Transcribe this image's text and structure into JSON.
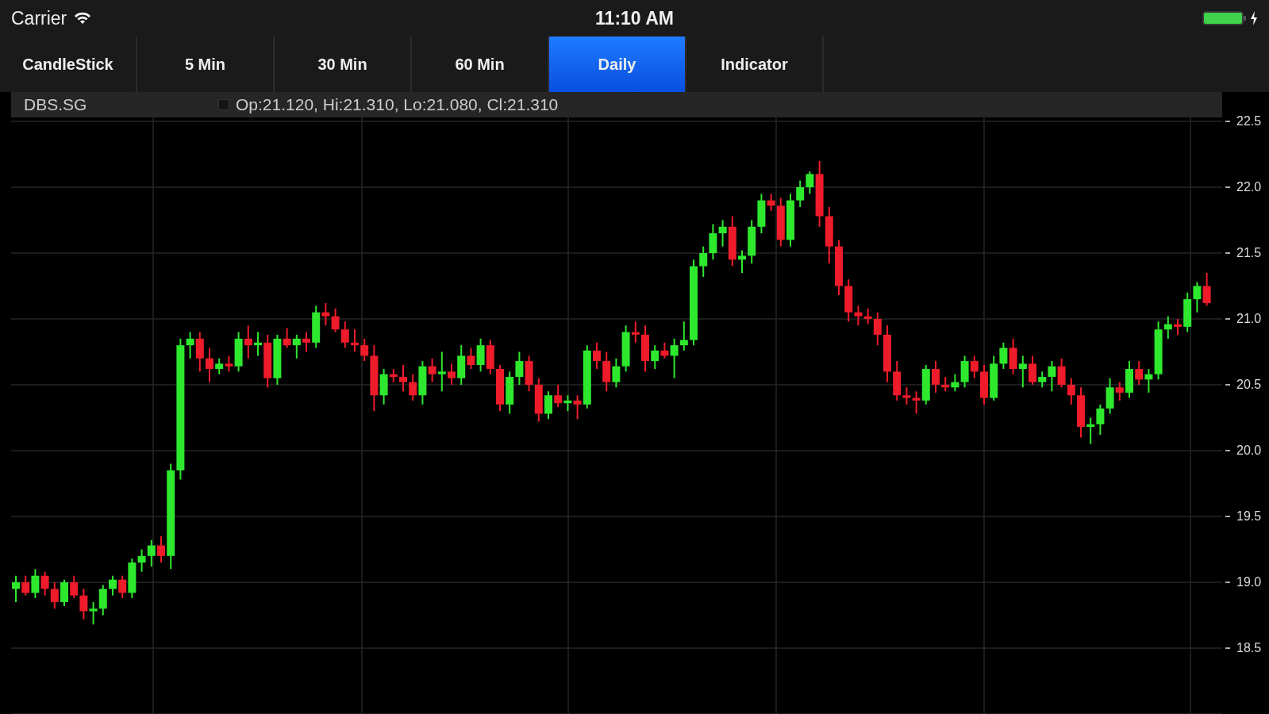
{
  "status_bar": {
    "carrier": "Carrier",
    "time": "11:10 AM"
  },
  "tabs": [
    {
      "label": "CandleStick",
      "selected": false
    },
    {
      "label": "5 Min",
      "selected": false
    },
    {
      "label": "30 Min",
      "selected": false
    },
    {
      "label": "60 Min",
      "selected": false
    },
    {
      "label": "Daily",
      "selected": true
    },
    {
      "label": "Indicator",
      "selected": false
    }
  ],
  "chart": {
    "symbol": "DBS.SG",
    "ohlc_readout": "Op:21.120, Hi:21.310, Lo:21.080, Cl:21.310",
    "chart_data": {
      "type": "candlestick",
      "grid": true,
      "ylim": [
        18.0,
        22.53
      ],
      "yticks": [
        {
          "value": 22.5,
          "label": "22.5"
        },
        {
          "value": 22.0,
          "label": "22.0"
        },
        {
          "value": 21.5,
          "label": "21.5"
        },
        {
          "value": 21.0,
          "label": "21.0"
        },
        {
          "value": 20.5,
          "label": "20.5"
        },
        {
          "value": 20.0,
          "label": "20.0"
        },
        {
          "value": 19.5,
          "label": "19.5"
        },
        {
          "value": 19.0,
          "label": "19.0"
        },
        {
          "value": 18.5,
          "label": "18.5"
        }
      ],
      "ohlc": [
        [
          18.95,
          19.05,
          18.85,
          19.0
        ],
        [
          19.0,
          19.05,
          18.9,
          18.92
        ],
        [
          18.92,
          19.1,
          18.88,
          19.05
        ],
        [
          19.05,
          19.08,
          18.9,
          18.95
        ],
        [
          18.95,
          19.0,
          18.8,
          18.85
        ],
        [
          18.85,
          19.02,
          18.82,
          19.0
        ],
        [
          19.0,
          19.05,
          18.88,
          18.9
        ],
        [
          18.9,
          18.95,
          18.72,
          18.78
        ],
        [
          18.78,
          18.85,
          18.68,
          18.8
        ],
        [
          18.8,
          18.98,
          18.75,
          18.95
        ],
        [
          18.95,
          19.05,
          18.9,
          19.02
        ],
        [
          19.02,
          19.05,
          18.88,
          18.92
        ],
        [
          18.92,
          19.18,
          18.88,
          19.15
        ],
        [
          19.15,
          19.25,
          19.08,
          19.2
        ],
        [
          19.2,
          19.32,
          19.12,
          19.28
        ],
        [
          19.28,
          19.35,
          19.15,
          19.2
        ],
        [
          19.2,
          19.9,
          19.1,
          19.85
        ],
        [
          19.85,
          20.85,
          19.78,
          20.8
        ],
        [
          20.8,
          20.9,
          20.7,
          20.85
        ],
        [
          20.85,
          20.9,
          20.6,
          20.7
        ],
        [
          20.7,
          20.78,
          20.52,
          20.62
        ],
        [
          20.62,
          20.7,
          20.58,
          20.66
        ],
        [
          20.66,
          20.72,
          20.6,
          20.64
        ],
        [
          20.64,
          20.9,
          20.6,
          20.85
        ],
        [
          20.85,
          20.95,
          20.7,
          20.8
        ],
        [
          20.8,
          20.9,
          20.72,
          20.82
        ],
        [
          20.82,
          20.88,
          20.48,
          20.55
        ],
        [
          20.55,
          20.88,
          20.5,
          20.85
        ],
        [
          20.85,
          20.93,
          20.78,
          20.8
        ],
        [
          20.8,
          20.88,
          20.7,
          20.85
        ],
        [
          20.85,
          20.9,
          20.75,
          20.82
        ],
        [
          20.82,
          21.1,
          20.78,
          21.05
        ],
        [
          21.05,
          21.12,
          20.95,
          21.02
        ],
        [
          21.02,
          21.08,
          20.9,
          20.92
        ],
        [
          20.92,
          20.98,
          20.78,
          20.82
        ],
        [
          20.82,
          20.92,
          20.75,
          20.8
        ],
        [
          20.8,
          20.85,
          20.68,
          20.72
        ],
        [
          20.72,
          20.8,
          20.3,
          20.42
        ],
        [
          20.42,
          20.62,
          20.35,
          20.58
        ],
        [
          20.58,
          20.62,
          20.52,
          20.56
        ],
        [
          20.56,
          20.65,
          20.45,
          20.52
        ],
        [
          20.52,
          20.58,
          20.38,
          20.42
        ],
        [
          20.42,
          20.68,
          20.35,
          20.64
        ],
        [
          20.64,
          20.7,
          20.52,
          20.58
        ],
        [
          20.58,
          20.75,
          20.45,
          20.6
        ],
        [
          20.6,
          20.66,
          20.5,
          20.55
        ],
        [
          20.55,
          20.8,
          20.5,
          20.72
        ],
        [
          20.72,
          20.78,
          20.62,
          20.65
        ],
        [
          20.65,
          20.85,
          20.6,
          20.8
        ],
        [
          20.8,
          20.84,
          20.58,
          20.62
        ],
        [
          20.62,
          20.65,
          20.3,
          20.35
        ],
        [
          20.35,
          20.6,
          20.28,
          20.56
        ],
        [
          20.56,
          20.75,
          20.5,
          20.68
        ],
        [
          20.68,
          20.72,
          20.45,
          20.5
        ],
        [
          20.5,
          20.55,
          20.22,
          20.28
        ],
        [
          20.28,
          20.45,
          20.24,
          20.42
        ],
        [
          20.42,
          20.5,
          20.33,
          20.36
        ],
        [
          20.36,
          20.42,
          20.3,
          20.38
        ],
        [
          20.38,
          20.42,
          20.24,
          20.35
        ],
        [
          20.35,
          20.8,
          20.32,
          20.76
        ],
        [
          20.76,
          20.82,
          20.62,
          20.68
        ],
        [
          20.68,
          20.75,
          20.45,
          20.52
        ],
        [
          20.52,
          20.7,
          20.48,
          20.64
        ],
        [
          20.64,
          20.95,
          20.6,
          20.9
        ],
        [
          20.9,
          20.98,
          20.82,
          20.88
        ],
        [
          20.88,
          20.95,
          20.6,
          20.68
        ],
        [
          20.68,
          20.8,
          20.62,
          20.76
        ],
        [
          20.76,
          20.82,
          20.7,
          20.72
        ],
        [
          20.72,
          20.85,
          20.55,
          20.8
        ],
        [
          20.8,
          20.98,
          20.76,
          20.84
        ],
        [
          20.84,
          21.45,
          20.8,
          21.4
        ],
        [
          21.4,
          21.55,
          21.32,
          21.5
        ],
        [
          21.5,
          21.72,
          21.45,
          21.65
        ],
        [
          21.65,
          21.75,
          21.55,
          21.7
        ],
        [
          21.7,
          21.78,
          21.4,
          21.45
        ],
        [
          21.45,
          21.52,
          21.35,
          21.48
        ],
        [
          21.48,
          21.75,
          21.42,
          21.7
        ],
        [
          21.7,
          21.95,
          21.65,
          21.9
        ],
        [
          21.9,
          21.95,
          21.82,
          21.86
        ],
        [
          21.86,
          21.92,
          21.55,
          21.6
        ],
        [
          21.6,
          21.95,
          21.55,
          21.9
        ],
        [
          21.9,
          22.05,
          21.85,
          22.0
        ],
        [
          22.0,
          22.12,
          21.95,
          22.1
        ],
        [
          22.1,
          22.2,
          21.7,
          21.78
        ],
        [
          21.78,
          21.85,
          21.42,
          21.55
        ],
        [
          21.55,
          21.6,
          21.18,
          21.25
        ],
        [
          21.25,
          21.3,
          20.98,
          21.05
        ],
        [
          21.05,
          21.1,
          20.95,
          21.02
        ],
        [
          21.02,
          21.08,
          20.96,
          21.0
        ],
        [
          21.0,
          21.05,
          20.8,
          20.88
        ],
        [
          20.88,
          20.95,
          20.52,
          20.6
        ],
        [
          20.6,
          20.68,
          20.38,
          20.42
        ],
        [
          20.42,
          20.48,
          20.35,
          20.4
        ],
        [
          20.4,
          20.45,
          20.28,
          20.38
        ],
        [
          20.38,
          20.65,
          20.35,
          20.62
        ],
        [
          20.62,
          20.68,
          20.44,
          20.5
        ],
        [
          20.5,
          20.56,
          20.45,
          20.48
        ],
        [
          20.48,
          20.58,
          20.45,
          20.52
        ],
        [
          20.52,
          20.72,
          20.48,
          20.68
        ],
        [
          20.68,
          20.72,
          20.55,
          20.6
        ],
        [
          20.6,
          20.65,
          20.35,
          20.4
        ],
        [
          20.4,
          20.72,
          20.38,
          20.66
        ],
        [
          20.66,
          20.82,
          20.62,
          20.78
        ],
        [
          20.78,
          20.85,
          20.58,
          20.62
        ],
        [
          20.62,
          20.72,
          20.48,
          20.66
        ],
        [
          20.66,
          20.72,
          20.5,
          20.52
        ],
        [
          20.52,
          20.6,
          20.48,
          20.56
        ],
        [
          20.56,
          20.68,
          20.45,
          20.64
        ],
        [
          20.64,
          20.7,
          20.48,
          20.5
        ],
        [
          20.5,
          20.55,
          20.35,
          20.42
        ],
        [
          20.42,
          20.48,
          20.1,
          20.18
        ],
        [
          20.18,
          20.25,
          20.05,
          20.2
        ],
        [
          20.2,
          20.35,
          20.12,
          20.32
        ],
        [
          20.32,
          20.55,
          20.28,
          20.48
        ],
        [
          20.48,
          20.52,
          20.38,
          20.44
        ],
        [
          20.44,
          20.68,
          20.4,
          20.62
        ],
        [
          20.62,
          20.68,
          20.5,
          20.54
        ],
        [
          20.54,
          20.62,
          20.44,
          20.58
        ],
        [
          20.58,
          20.98,
          20.54,
          20.92
        ],
        [
          20.92,
          21.02,
          20.85,
          20.96
        ],
        [
          20.96,
          21.0,
          20.88,
          20.94
        ],
        [
          20.94,
          21.2,
          20.9,
          21.15
        ],
        [
          21.15,
          21.28,
          21.05,
          21.25
        ],
        [
          21.25,
          21.35,
          21.1,
          21.12
        ]
      ]
    }
  }
}
